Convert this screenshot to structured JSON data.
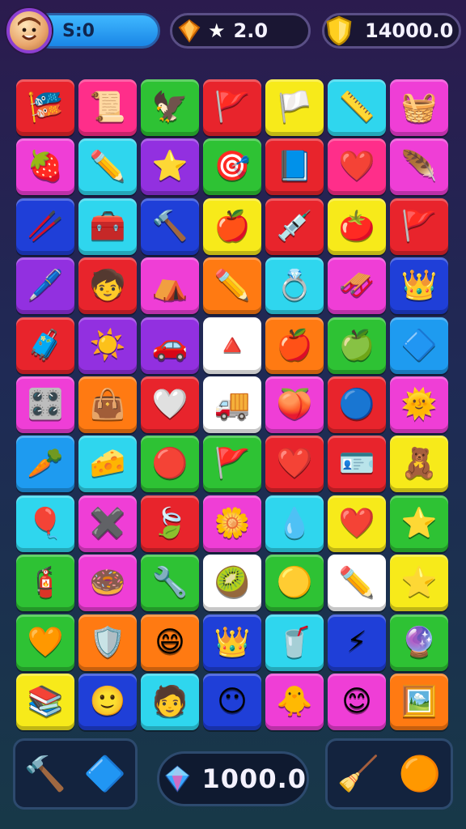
{
  "hud": {
    "level_text": "S:0",
    "stars_value": "2.0",
    "coins_value": "14000.0"
  },
  "board": {
    "tiles": [
      {
        "color": "#e8242c",
        "icon": "🎏",
        "name": "banner-icon"
      },
      {
        "color": "#ff2e8a",
        "icon": "📜",
        "name": "scroll-icon"
      },
      {
        "color": "#2ec234",
        "icon": "🦅",
        "name": "bird-icon"
      },
      {
        "color": "#e8242c",
        "icon": "🚩",
        "name": "flag-icon"
      },
      {
        "color": "#f7ea1a",
        "icon": "🏳️",
        "name": "white-flag-icon"
      },
      {
        "color": "#2fd6ee",
        "icon": "📏",
        "name": "ruler-icon"
      },
      {
        "color": "#ef3ed6",
        "icon": "🧺",
        "name": "basket-icon"
      },
      {
        "color": "#ef3ed6",
        "icon": "🍓",
        "name": "strawberry-icon"
      },
      {
        "color": "#2fd6ee",
        "icon": "✏️",
        "name": "pencil-icon"
      },
      {
        "color": "#9230e0",
        "icon": "⭐",
        "name": "star-icon"
      },
      {
        "color": "#2ec234",
        "icon": "🎯",
        "name": "target-icon"
      },
      {
        "color": "#e8242c",
        "icon": "📘",
        "name": "book-icon"
      },
      {
        "color": "#ff2e8a",
        "icon": "❤️",
        "name": "heart-icon"
      },
      {
        "color": "#ef3ed6",
        "icon": "🪶",
        "name": "feather-icon"
      },
      {
        "color": "#1f3fd8",
        "icon": "🥢",
        "name": "stick-icon"
      },
      {
        "color": "#2fd6ee",
        "icon": "🧰",
        "name": "first-aid-kit-icon"
      },
      {
        "color": "#1f3fd8",
        "icon": "🔨",
        "name": "hammer-icon"
      },
      {
        "color": "#f7ea1a",
        "icon": "🍎",
        "name": "apple-icon"
      },
      {
        "color": "#e8242c",
        "icon": "💉",
        "name": "syringe-icon"
      },
      {
        "color": "#f7ea1a",
        "icon": "🍅",
        "name": "tomato-icon"
      },
      {
        "color": "#e8242c",
        "icon": "🚩",
        "name": "flag-icon"
      },
      {
        "color": "#9230e0",
        "icon": "🖊️",
        "name": "pen-icon"
      },
      {
        "color": "#e8242c",
        "icon": "🧒",
        "name": "kid-face-icon"
      },
      {
        "color": "#ef3ed6",
        "icon": "⛺",
        "name": "tent-icon"
      },
      {
        "color": "#ff7a12",
        "icon": "✏️",
        "name": "pencil-icon"
      },
      {
        "color": "#2fd6ee",
        "icon": "💍",
        "name": "ring-icon"
      },
      {
        "color": "#ef3ed6",
        "icon": "🛷",
        "name": "sled-icon"
      },
      {
        "color": "#1f3fd8",
        "icon": "👑",
        "name": "crown-icon"
      },
      {
        "color": "#e8242c",
        "icon": "🧳",
        "name": "briefcase-icon"
      },
      {
        "color": "#9230e0",
        "icon": "☀️",
        "name": "sun-icon"
      },
      {
        "color": "#9230e0",
        "icon": "🚗",
        "name": "car-icon"
      },
      {
        "color": "#ffffff",
        "icon": "🔺",
        "name": "triangle-icon"
      },
      {
        "color": "#ff7a12",
        "icon": "🍎",
        "name": "apple-icon"
      },
      {
        "color": "#2ec234",
        "icon": "🍏",
        "name": "green-apple-icon"
      },
      {
        "color": "#1e9bf0",
        "icon": "🔷",
        "name": "shield-gem-icon"
      },
      {
        "color": "#ef3ed6",
        "icon": "🎛️",
        "name": "control-panel-icon"
      },
      {
        "color": "#ff7a12",
        "icon": "👜",
        "name": "bag-icon"
      },
      {
        "color": "#e8242c",
        "icon": "🤍",
        "name": "white-heart-icon"
      },
      {
        "color": "#ffffff",
        "icon": "🚚",
        "name": "vehicle-icon"
      },
      {
        "color": "#ef3ed6",
        "icon": "🍑",
        "name": "peach-icon"
      },
      {
        "color": "#e8242c",
        "icon": "🔵",
        "name": "blue-ball-icon"
      },
      {
        "color": "#ef3ed6",
        "icon": "🌞",
        "name": "sun-flower-icon"
      },
      {
        "color": "#1e9bf0",
        "icon": "🥕",
        "name": "carrot-icon"
      },
      {
        "color": "#2fd6ee",
        "icon": "🧀",
        "name": "cheese-icon"
      },
      {
        "color": "#2ec234",
        "icon": "🔴",
        "name": "red-badge-icon"
      },
      {
        "color": "#2ec234",
        "icon": "🚩",
        "name": "flag-icon"
      },
      {
        "color": "#e8242c",
        "icon": "❤️",
        "name": "heart-icon"
      },
      {
        "color": "#e8242c",
        "icon": "🪪",
        "name": "id-card-icon"
      },
      {
        "color": "#f7ea1a",
        "icon": "🧸",
        "name": "toy-icon"
      },
      {
        "color": "#2fd6ee",
        "icon": "🎈",
        "name": "balloon-icon"
      },
      {
        "color": "#ef3ed6",
        "icon": "✖️",
        "name": "cross-icon"
      },
      {
        "color": "#e8242c",
        "icon": "🍃",
        "name": "leaf-icon"
      },
      {
        "color": "#ef3ed6",
        "icon": "🌼",
        "name": "flower-icon"
      },
      {
        "color": "#2fd6ee",
        "icon": "💧",
        "name": "drop-icon"
      },
      {
        "color": "#f7ea1a",
        "icon": "❤️",
        "name": "heart-icon"
      },
      {
        "color": "#2ec234",
        "icon": "⭐",
        "name": "star-icon"
      },
      {
        "color": "#2ec234",
        "icon": "🧯",
        "name": "extinguisher-icon"
      },
      {
        "color": "#ef3ed6",
        "icon": "🍩",
        "name": "donut-icon"
      },
      {
        "color": "#2ec234",
        "icon": "🔧",
        "name": "wrench-icon"
      },
      {
        "color": "#ffffff",
        "icon": "🥝",
        "name": "kiwi-icon"
      },
      {
        "color": "#2ec234",
        "icon": "🟡",
        "name": "yellow-ball-icon"
      },
      {
        "color": "#ffffff",
        "icon": "✏️",
        "name": "pencil-icon"
      },
      {
        "color": "#f7ea1a",
        "icon": "⭐",
        "name": "star-icon"
      },
      {
        "color": "#2ec234",
        "icon": "🧡",
        "name": "orange-heart-icon"
      },
      {
        "color": "#ff7a12",
        "icon": "🛡️",
        "name": "shield-icon"
      },
      {
        "color": "#ff7a12",
        "icon": "😄",
        "name": "smiley-face-icon"
      },
      {
        "color": "#1f3fd8",
        "icon": "👑",
        "name": "crown-icon"
      },
      {
        "color": "#2fd6ee",
        "icon": "🥤",
        "name": "cup-icon"
      },
      {
        "color": "#1f3fd8",
        "icon": "⚡",
        "name": "bolt-icon"
      },
      {
        "color": "#2ec234",
        "icon": "🔮",
        "name": "crystal-ball-icon"
      },
      {
        "color": "#f7ea1a",
        "icon": "📚",
        "name": "books-icon"
      },
      {
        "color": "#1f3fd8",
        "icon": "🙂",
        "name": "kid-face-icon"
      },
      {
        "color": "#2fd6ee",
        "icon": "🧑",
        "name": "boy-face-icon"
      },
      {
        "color": "#1f3fd8",
        "icon": "😶",
        "name": "face-icon"
      },
      {
        "color": "#ef3ed6",
        "icon": "🐥",
        "name": "chick-icon"
      },
      {
        "color": "#ef3ed6",
        "icon": "😊",
        "name": "smile-icon"
      },
      {
        "color": "#ff7a12",
        "icon": "🖼️",
        "name": "portrait-icon"
      }
    ]
  },
  "bottom": {
    "gem_counter": "1000.0",
    "left_tools": [
      {
        "icon": "🔨",
        "name": "hammer-tool-icon"
      },
      {
        "icon": "🔷",
        "name": "shape-tool-icon"
      }
    ],
    "right_tools": [
      {
        "icon": "🧹",
        "name": "eraser-tool-icon"
      },
      {
        "icon": "🟠",
        "name": "blob-booster-icon"
      }
    ]
  }
}
